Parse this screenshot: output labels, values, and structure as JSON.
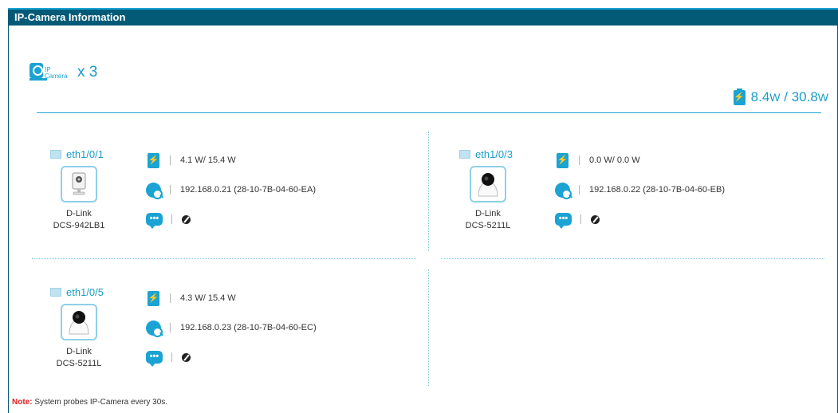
{
  "window": {
    "title": "IP-Camera Information"
  },
  "summary": {
    "badge_line1": "IP",
    "badge_line2": "Camera",
    "camera_count": "x 3",
    "power_used": "8.4",
    "power_used_unit": "W",
    "power_separator": " / ",
    "power_budget": "30.8",
    "power_budget_unit": "W"
  },
  "ports": [
    {
      "name": "eth1/0/1",
      "power": "4.1 W/ 15.4 W",
      "address": "192.168.0.21 (28-10-7B-04-60-EA)",
      "vendor": "D-Link",
      "model": "DCS-942LB1",
      "camera_type": "cube-camera"
    },
    {
      "name": "eth1/0/3",
      "power": "0.0 W/ 0.0 W",
      "address": "192.168.0.22 (28-10-7B-04-60-EB)",
      "vendor": "D-Link",
      "model": "DCS-5211L",
      "camera_type": "pan-tilt-camera"
    },
    {
      "name": "eth1/0/5",
      "power": "4.3 W/ 15.4 W",
      "address": "192.168.0.23 (28-10-7B-04-60-EC)",
      "vendor": "D-Link",
      "model": "DCS-5211L",
      "camera_type": "pan-tilt-camera"
    }
  ],
  "icons": {
    "power": "battery-icon",
    "address": "globe-search-icon",
    "message": "chat-bubble-icon",
    "no_message": "no-entry-icon"
  },
  "footer": {
    "note_label": "Note:",
    "note_text": "System probes IP-Camera every 30s."
  },
  "colors": {
    "header_bg": "#035a77",
    "accent": "#1aa3d3",
    "note_label": "#e02020"
  }
}
